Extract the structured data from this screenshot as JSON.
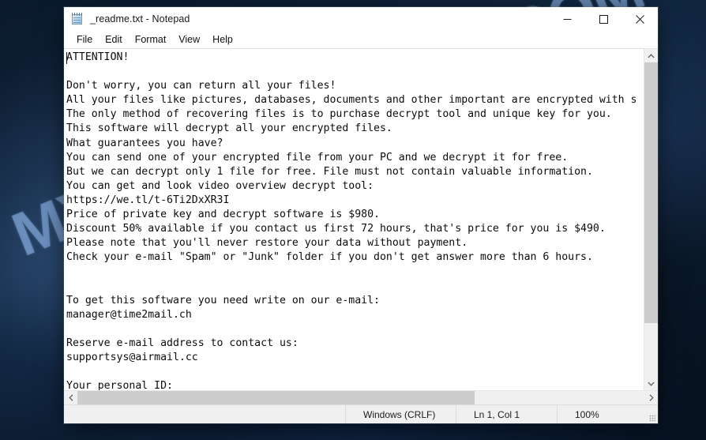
{
  "desktop": {
    "watermark": "MYANTISPYWARE.COM",
    "background_color": "#0d1b2e",
    "watermark_color": "#96beF5"
  },
  "window": {
    "title": "_readme.txt - Notepad",
    "icon": "notepad-icon",
    "caption": {
      "minimize": "minimize-icon",
      "maximize": "maximize-icon",
      "close": "close-icon"
    }
  },
  "menu": {
    "items": [
      {
        "label": "File"
      },
      {
        "label": "Edit"
      },
      {
        "label": "Format"
      },
      {
        "label": "View"
      },
      {
        "label": "Help"
      }
    ]
  },
  "editor": {
    "text": "ATTENTION!\n\nDon't worry, you can return all your files!\nAll your files like pictures, databases, documents and other important are encrypted with s\nThe only method of recovering files is to purchase decrypt tool and unique key for you.\nThis software will decrypt all your encrypted files.\nWhat guarantees you have?\nYou can send one of your encrypted file from your PC and we decrypt it for free.\nBut we can decrypt only 1 file for free. File must not contain valuable information.\nYou can get and look video overview decrypt tool:\nhttps://we.tl/t-6Ti2DxXR3I\nPrice of private key and decrypt software is $980.\nDiscount 50% available if you contact us first 72 hours, that's price for you is $490.\nPlease note that you'll never restore your data without payment.\nCheck your e-mail \"Spam\" or \"Junk\" folder if you don't get answer more than 6 hours.\n\n\nTo get this software you need write on our e-mail:\nmanager@time2mail.ch\n\nReserve e-mail address to contact us:\nsupportsys@airmail.cc\n\nYour personal ID:",
    "ransom_details": {
      "price_full": "$980",
      "price_discount": "$490",
      "discount_percent": "50%",
      "discount_window_hours": "72",
      "response_time_hours": "6",
      "video_url": "https://we.tl/t-6Ti2DxXR3I",
      "primary_email": "manager@time2mail.ch",
      "reserve_email": "supportsys@airmail.cc",
      "free_files": "1"
    }
  },
  "scrollbars": {
    "vertical": {
      "up_arrow": "chevron-up-icon",
      "down_arrow": "chevron-down-icon",
      "thumb_fraction": 0.83
    },
    "horizontal": {
      "left_arrow": "chevron-left-icon",
      "right_arrow": "chevron-right-icon",
      "thumb_fraction": 0.7
    }
  },
  "status_bar": {
    "encoding": "Windows (CRLF)",
    "position": "Ln 1, Col 1",
    "zoom": "100%"
  }
}
